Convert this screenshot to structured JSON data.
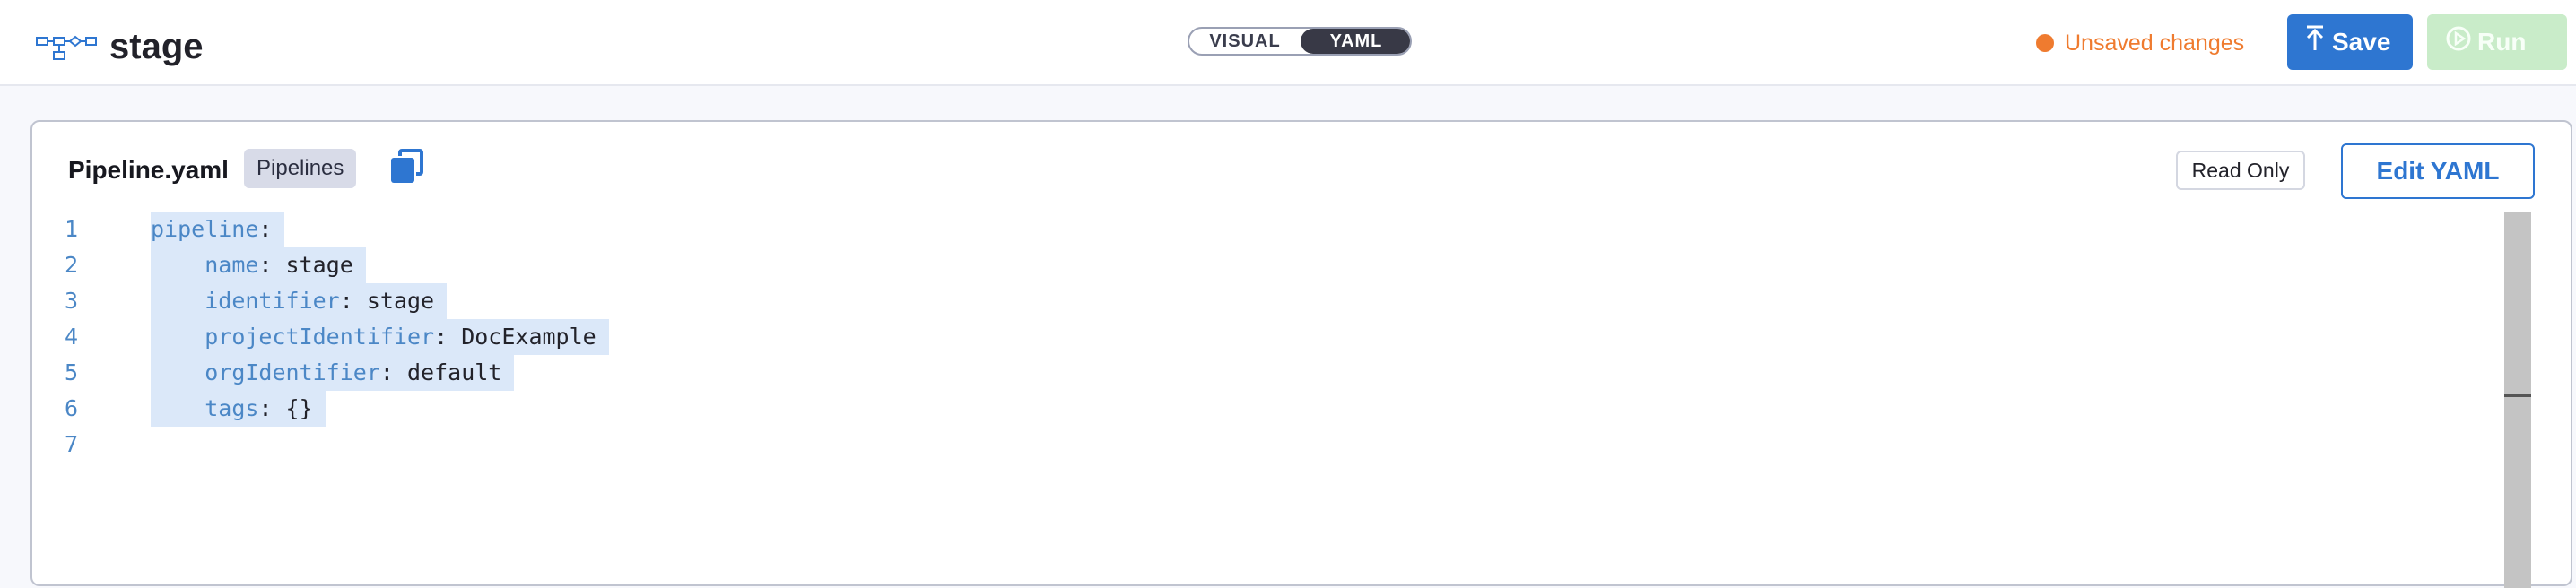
{
  "header": {
    "title": "stage",
    "view_toggle": {
      "visual_label": "VISUAL",
      "yaml_label": "YAML",
      "selected": "YAML"
    },
    "status_text": "Unsaved changes",
    "save_label": "Save",
    "run_label": "Run"
  },
  "editor": {
    "filename": "Pipeline.yaml",
    "tag": "Pipelines",
    "read_only_label": "Read Only",
    "edit_label": "Edit YAML",
    "lines": [
      {
        "num": "1",
        "key": "pipeline",
        "value": ""
      },
      {
        "num": "2",
        "key": "name",
        "value": "stage"
      },
      {
        "num": "3",
        "key": "identifier",
        "value": "stage"
      },
      {
        "num": "4",
        "key": "projectIdentifier",
        "value": "DocExample"
      },
      {
        "num": "5",
        "key": "orgIdentifier",
        "value": "default"
      },
      {
        "num": "6",
        "key": "tags",
        "value": "{}"
      },
      {
        "num": "7",
        "key": "",
        "value": ""
      }
    ]
  },
  "colors": {
    "accent": "#2e76d1",
    "status": "#ef7b2f",
    "run_disabled": "#c9ecc9",
    "code_key": "#4b87c6",
    "selection": "#dbe8f9"
  },
  "icons": [
    "pipeline-icon",
    "upload-icon",
    "play-circle-icon",
    "copy-icon"
  ]
}
